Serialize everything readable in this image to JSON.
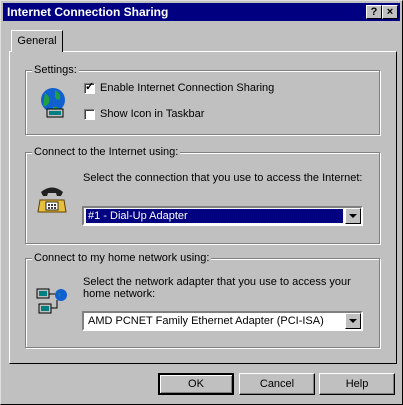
{
  "window": {
    "title": "Internet Connection Sharing",
    "help_glyph": "?",
    "close_glyph": "×"
  },
  "tabs": [
    {
      "label": "General"
    }
  ],
  "settings": {
    "group_label": "Settings:",
    "enable_label": "Enable Internet Connection Sharing",
    "enable_checked": true,
    "show_icon_label": "Show Icon in Taskbar",
    "show_icon_checked": false,
    "icon": "globe-computer-icon"
  },
  "internet": {
    "group_label": "Connect to the Internet using:",
    "prompt": "Select the connection that you use to access the Internet:",
    "selected": "#1 - Dial-Up Adapter",
    "icon": "telephone-icon"
  },
  "home": {
    "group_label": "Connect to my home network using:",
    "prompt_line1": "Select the network adapter that you use to access your",
    "prompt_line2": "home network:",
    "selected": "AMD PCNET Family Ethernet Adapter (PCI-ISA)",
    "icon": "network-computers-icon"
  },
  "buttons": {
    "ok": "OK",
    "cancel": "Cancel",
    "help": "Help"
  }
}
